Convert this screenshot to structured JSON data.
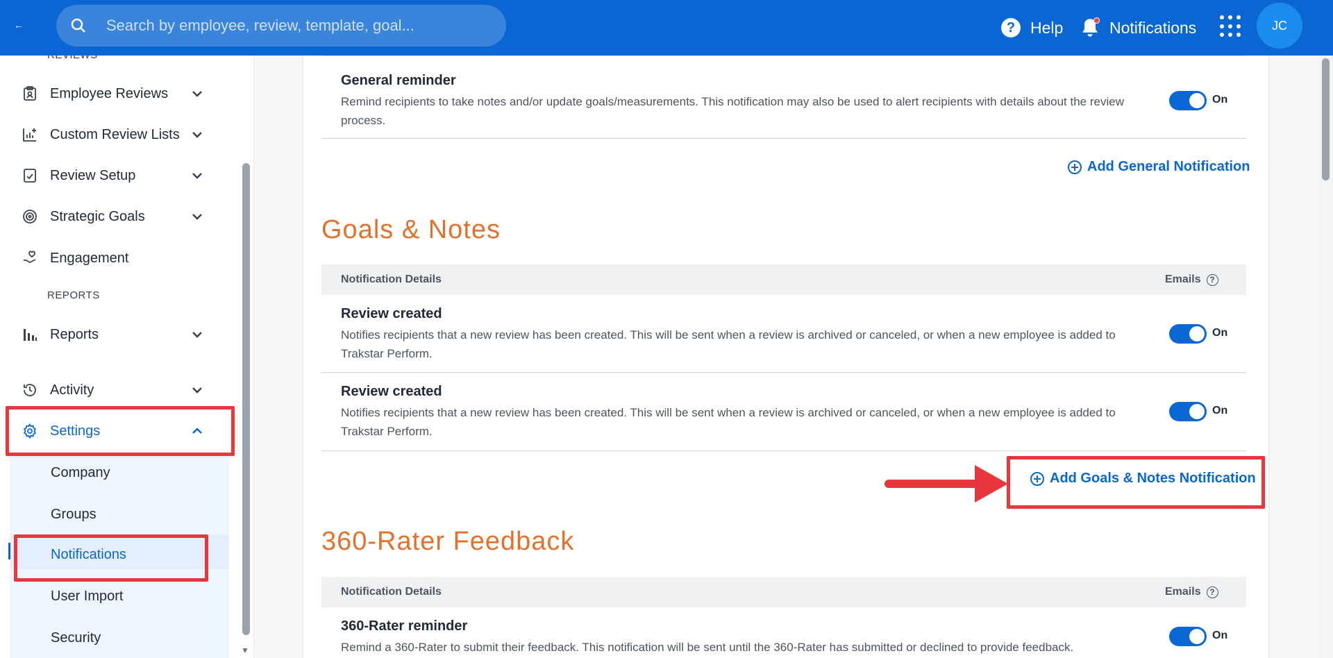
{
  "topbar": {
    "back_label": "←",
    "search_placeholder": "Search by employee, review, template, goal...",
    "help_label": "Help",
    "notifications_label": "Notifications",
    "avatar_initials": "JC",
    "bar_color": "#0a66d3"
  },
  "sidebar": {
    "reviews_heading": "REVIEWS",
    "items": [
      {
        "label": "Employee Reviews",
        "icon": "clipboard-user-icon"
      },
      {
        "label": "Custom Review Lists",
        "icon": "chart-plus-icon"
      },
      {
        "label": "Review Setup",
        "icon": "clipboard-check-icon"
      },
      {
        "label": "Strategic Goals",
        "icon": "target-icon"
      },
      {
        "label": "Engagement",
        "icon": "hand-heart-icon"
      }
    ],
    "reports_heading": "REPORTS",
    "reports_label": "Reports",
    "activity_label": "Activity",
    "settings_label": "Settings",
    "settings_sub": [
      "Company",
      "Groups",
      "Notifications",
      "User Import",
      "Security"
    ]
  },
  "main": {
    "general": {
      "title": "General reminder",
      "desc": "Remind recipients to take notes and/or update goals/measurements. This notification may also be used to alert recipients with details about the review process.",
      "toggle_label": "On",
      "add_label": "Add General Notification"
    },
    "goals_notes": {
      "section_title": "Goals & Notes",
      "header_details": "Notification Details",
      "header_emails": "Emails",
      "rows": [
        {
          "title": "Review created",
          "desc": "Notifies recipients that a new review has been created. This will be sent when a review is archived or canceled, or when a new employee is added to Trakstar Perform.",
          "toggle_label": "On"
        },
        {
          "title": "Review created",
          "desc": "Notifies recipients that a new review has been created. This will be sent when a review is archived or canceled, or when a new employee is added to Trakstar Perform.",
          "toggle_label": "On"
        }
      ],
      "add_label": "Add Goals & Notes Notification"
    },
    "rater": {
      "section_title": "360-Rater Feedback",
      "header_details": "Notification Details",
      "header_emails": "Emails",
      "row_title": "360-Rater reminder",
      "row_desc": "Remind a 360-Rater to submit their feedback. This notification will be sent until the 360-Rater has submitted or declined to provide feedback.",
      "toggle_label": "On"
    }
  },
  "colors": {
    "accent": "#0a66d3",
    "section_title": "#e2722b",
    "annotation": "#e8363d"
  }
}
